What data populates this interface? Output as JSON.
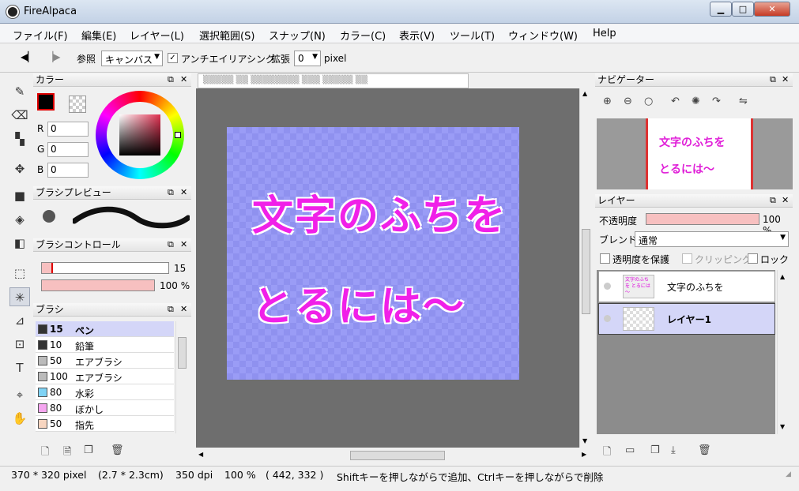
{
  "window": {
    "title": "FireAlpaca",
    "min": "▁",
    "max": "□",
    "close": "✕"
  },
  "menu": [
    "ファイル(F)",
    "編集(E)",
    "レイヤー(L)",
    "選択範囲(S)",
    "スナップ(N)",
    "カラー(C)",
    "表示(V)",
    "ツール(T)",
    "ウィンドウ(W)",
    "Help"
  ],
  "toolbar": {
    "reference_label": "参照",
    "reference_value": "キャンバス",
    "antialias_label": "アンチエイリアシング",
    "expand_label": "拡張",
    "expand_value": "0",
    "unit": "pixel"
  },
  "color_panel": {
    "title": "カラー",
    "r_label": "R",
    "g_label": "G",
    "b_label": "B",
    "r": "0",
    "g": "0",
    "b": "0"
  },
  "brush_preview_panel": {
    "title": "ブラシプレビュー"
  },
  "brush_control_panel": {
    "title": "ブラシコントロール",
    "size": "15",
    "opacity": "100 %"
  },
  "brush_panel": {
    "title": "ブラシ",
    "items": [
      {
        "size": "15",
        "name": "ペン",
        "color": "#333333"
      },
      {
        "size": "10",
        "name": "鉛筆",
        "color": "#333333"
      },
      {
        "size": "50",
        "name": "エアブラシ",
        "color": "#bbbbbb"
      },
      {
        "size": "100",
        "name": "エアブラシ",
        "color": "#bbbbbb"
      },
      {
        "size": "80",
        "name": "水彩",
        "color": "#7fd3f5"
      },
      {
        "size": "80",
        "name": "ぼかし",
        "color": "#f5a6f0"
      },
      {
        "size": "50",
        "name": "指先",
        "color": "#f7d5c0"
      }
    ]
  },
  "document": {
    "tab_title": "▒▒▒▒▒ ▒▒ ▒▒▒▒▒▒▒▒ ▒▒▒ ▒▒▒▒▒ ▒▒",
    "line1": "文字のふちを",
    "line2": "とるには～"
  },
  "navigator_panel": {
    "title": "ナビゲーター",
    "thumb_line1": "文字のふちを",
    "thumb_line2": "とるには～"
  },
  "layer_panel": {
    "title": "レイヤー",
    "opacity_label": "不透明度",
    "opacity_value": "100 %",
    "blend_label": "ブレンド",
    "blend_value": "通常",
    "protect_label": "透明度を保護",
    "clipping_label": "クリッピング",
    "lock_label": "ロック",
    "layers": [
      {
        "name": "文字のふちを"
      },
      {
        "name": "レイヤー1"
      }
    ],
    "thumb_text": "文字のふちを とるには～"
  },
  "status": {
    "size": "370 * 320 pixel",
    "cm": "(2.7 * 2.3cm)",
    "dpi": "350 dpi",
    "zoom": "100 %",
    "coords": "( 442, 332 )",
    "hint": "Shiftキーを押しながらで追加、Ctrlキーを押しながらで削除"
  }
}
